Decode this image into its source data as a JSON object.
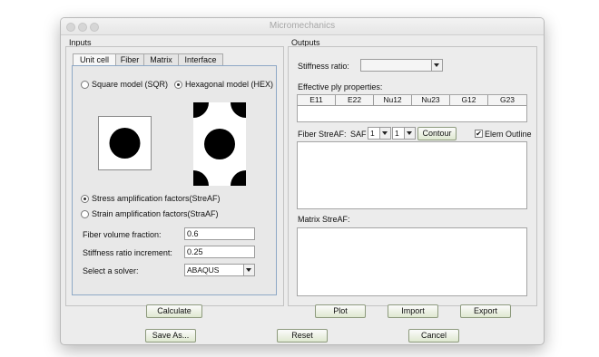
{
  "window": {
    "title": "Micromechanics"
  },
  "inputs": {
    "title": "Inputs",
    "tabs": [
      "Unit cell",
      "Fiber",
      "Matrix",
      "Interface"
    ],
    "models": {
      "square_label": "Square model (SQR)",
      "hex_label": "Hexagonal model (HEX)",
      "selected": "hex"
    },
    "factors": {
      "stress_label": "Stress amplification factors(StreAF)",
      "strain_label": "Strain amplification factors(StraAF)",
      "selected": "stress"
    },
    "fiber_volume_label": "Fiber volume fraction:",
    "fiber_volume_value": "0.6",
    "stiffness_inc_label": "Stiffness ratio increment:",
    "stiffness_inc_value": "0.25",
    "solver_label": "Select a solver:",
    "solver_value": "ABAQUS",
    "calculate_label": "Calculate"
  },
  "outputs": {
    "title": "Outputs",
    "stiffness_ratio_label": "Stiffness ratio:",
    "stiffness_ratio_value": "",
    "ply_props_label": "Effective ply properties:",
    "columns": [
      "E11",
      "E22",
      "Nu12",
      "Nu23",
      "G12",
      "G23"
    ],
    "fiber_streaf_label": "Fiber StreAF:",
    "saf_label": "SAF",
    "saf_index_1": "1",
    "saf_index_2": "1",
    "contour_label": "Contour",
    "elem_outline_label": "Elem Outline",
    "elem_outline_checked": true,
    "matrix_streaf_label": "Matrix StreAF:",
    "plot_label": "Plot",
    "import_label": "Import",
    "export_label": "Export"
  },
  "footer": {
    "save_as_label": "Save As...",
    "reset_label": "Reset",
    "cancel_label": "Cancel"
  }
}
